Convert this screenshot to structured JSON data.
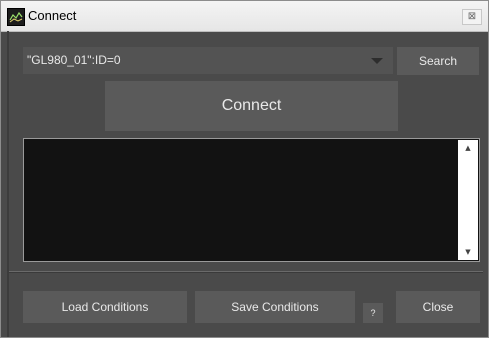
{
  "window": {
    "title": "Connect",
    "close_glyph": "⊠"
  },
  "device": {
    "selected": "\"GL980_01\":ID=0"
  },
  "buttons": {
    "search": "Search",
    "connect": "Connect",
    "load_conditions": "Load Conditions",
    "save_conditions": "Save Conditions",
    "help": "?",
    "close": "Close"
  },
  "log": {
    "scroll_up": "▲",
    "scroll_down": "▼"
  },
  "colors": {
    "background": "#4a4a4a",
    "button": "#5a5a5a",
    "log_background": "#121212"
  }
}
